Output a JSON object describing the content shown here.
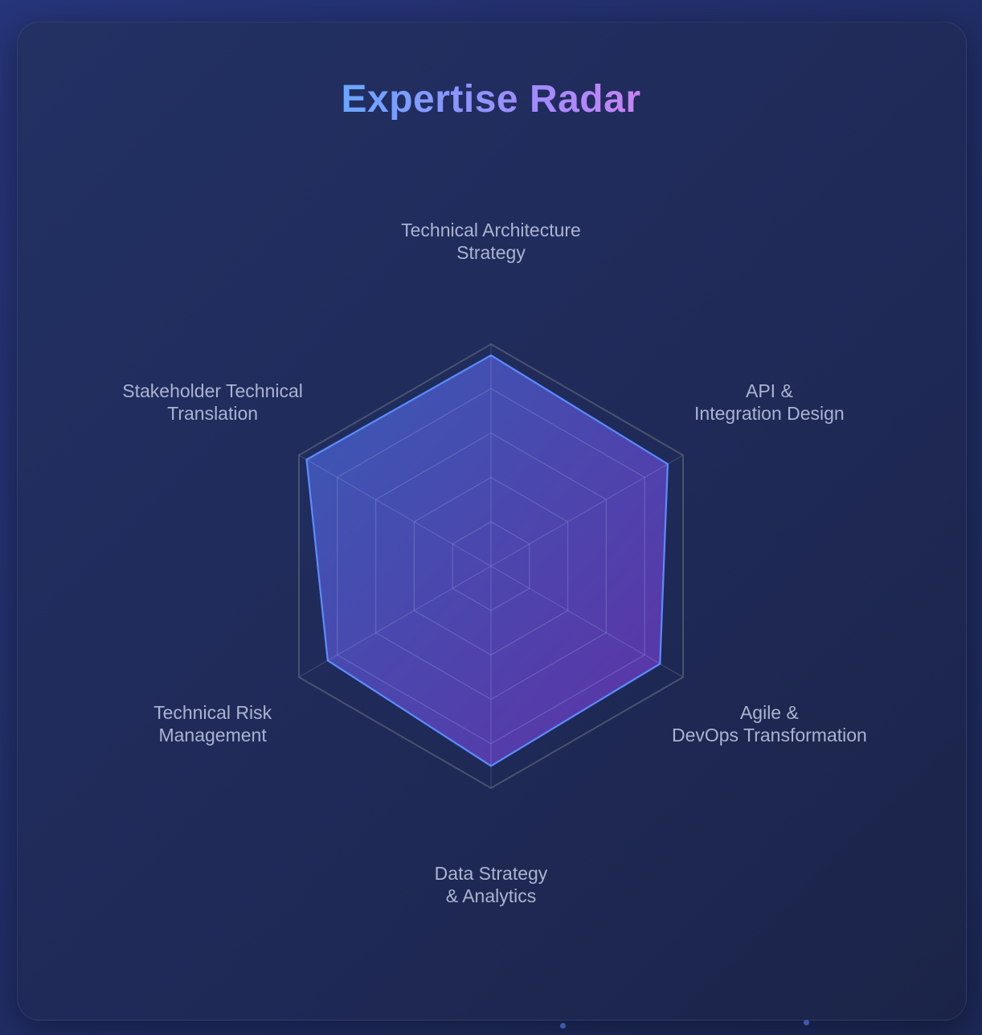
{
  "title": "Expertise Radar",
  "chart_data": {
    "type": "radar",
    "title": "Expertise Radar",
    "axes": [
      [
        "Technical Architecture",
        "Strategy"
      ],
      [
        "API &",
        "Integration Design"
      ],
      [
        "Agile &",
        "DevOps Transformation"
      ],
      [
        "Data Strategy",
        "& Analytics"
      ],
      [
        "Technical Risk",
        "Management"
      ],
      [
        "Stakeholder Technical",
        "Translation"
      ]
    ],
    "range": [
      0,
      100
    ],
    "grid_levels": [
      20,
      40,
      60,
      80,
      100
    ],
    "series": [
      {
        "values": [
          95,
          92,
          88,
          90,
          85,
          96
        ],
        "fill_start": "#3f64c8",
        "fill_end": "#6b35b8",
        "stroke": "#5b8cff"
      }
    ],
    "grid_color": "#5a6585",
    "outer_grid_color": "#4e5670"
  }
}
